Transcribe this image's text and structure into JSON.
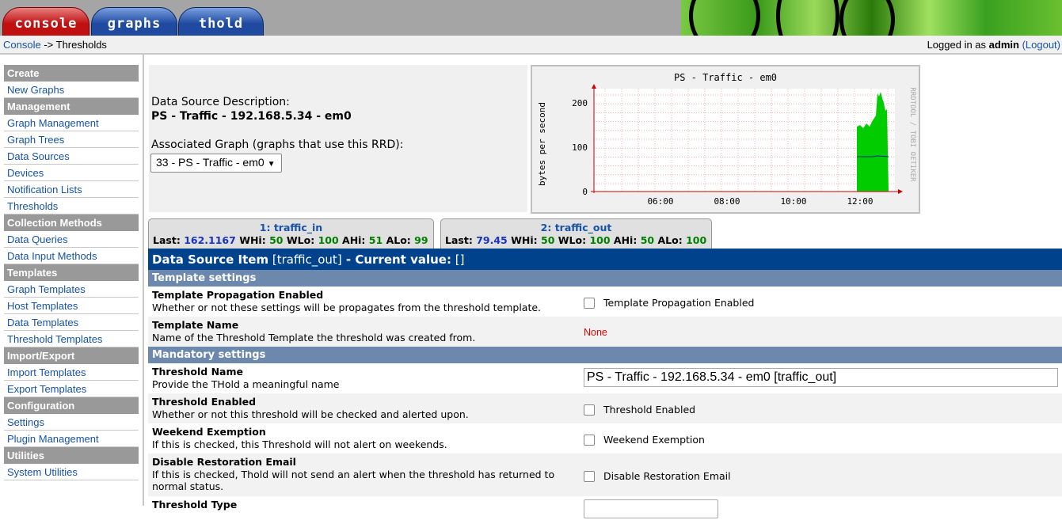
{
  "tabs": [
    {
      "label": "console"
    },
    {
      "label": "graphs"
    },
    {
      "label": "thold"
    }
  ],
  "breadcrumb": {
    "root": "Console",
    "sep": " -> ",
    "current": "Thresholds"
  },
  "login": {
    "prefix": "Logged in as ",
    "user": "admin",
    "logout": "(Logout)"
  },
  "sidebar": {
    "sections": [
      {
        "title": "Create",
        "items": [
          "New Graphs"
        ]
      },
      {
        "title": "Management",
        "items": [
          "Graph Management",
          "Graph Trees",
          "Data Sources",
          "Devices",
          "Notification Lists",
          "Thresholds"
        ]
      },
      {
        "title": "Collection Methods",
        "items": [
          "Data Queries",
          "Data Input Methods"
        ]
      },
      {
        "title": "Templates",
        "items": [
          "Graph Templates",
          "Host Templates",
          "Data Templates",
          "Threshold Templates"
        ]
      },
      {
        "title": "Import/Export",
        "items": [
          "Import Templates",
          "Export Templates"
        ]
      },
      {
        "title": "Configuration",
        "items": [
          "Settings",
          "Plugin Management"
        ]
      },
      {
        "title": "Utilities",
        "items": [
          "System Utilities"
        ]
      }
    ]
  },
  "info": {
    "ds_desc_label": "Data Source Description:",
    "ds_desc_value": "PS - Traffic - 192.168.5.34 - em0",
    "assoc_label": "Associated Graph (graphs that use this RRD):",
    "assoc_select": "33 - PS - Traffic - em0"
  },
  "graph": {
    "title": "PS - Traffic - em0",
    "ylabel": "bytes per second",
    "watermark": "RRDTOOL / TOBI OETIKER",
    "yticks": [
      "200",
      "100",
      "0"
    ],
    "xticks": [
      "06:00",
      "08:00",
      "10:00",
      "12:00"
    ],
    "colors": {
      "area": "#00cc00",
      "line": "#002a97",
      "axis": "#cc0000"
    }
  },
  "dstabs": [
    {
      "title": "1: traffic_in",
      "last_label": "Last:",
      "last": "162.1167",
      "whi_label": "WHi:",
      "whi": "50",
      "wlo_label": "WLo:",
      "wlo": "100",
      "ahi_label": "AHi:",
      "ahi": "51",
      "alo_label": "ALo:",
      "alo": "99"
    },
    {
      "title": "2: traffic_out",
      "last_label": "Last:",
      "last": "79.45",
      "whi_label": "WHi:",
      "whi": "50",
      "wlo_label": "WLo:",
      "wlo": "100",
      "ahi_label": "AHi:",
      "ahi": "50",
      "alo_label": "ALo:",
      "alo": "100"
    }
  ],
  "main": {
    "head_prefix": "Data Source Item",
    "head_item": "[traffic_out]",
    "head_sep": " - ",
    "head_current": "Current value:",
    "head_value": "[]",
    "sections": {
      "template": "Template settings",
      "mandatory": "Mandatory settings"
    },
    "rows": {
      "tpl_prop": {
        "label": "Template Propagation Enabled",
        "desc": "Whether or not these settings will be propagates from the threshold template.",
        "control": "Template Propagation Enabled"
      },
      "tpl_name": {
        "label": "Template Name",
        "desc": "Name of the Threshold Template the threshold was created from.",
        "value": "None"
      },
      "th_name": {
        "label": "Threshold Name",
        "desc": "Provide the THold a meaningful name",
        "value": "PS - Traffic - 192.168.5.34 - em0 [traffic_out]"
      },
      "th_enabled": {
        "label": "Threshold Enabled",
        "desc": "Whether or not this threshold will be checked and alerted upon.",
        "control": "Threshold Enabled"
      },
      "weekend": {
        "label": "Weekend Exemption",
        "desc": "If this is checked, this Threshold will not alert on weekends.",
        "control": "Weekend Exemption"
      },
      "restore": {
        "label": "Disable Restoration Email",
        "desc": "If this is checked, Thold will not send an alert when the threshold has returned to normal status.",
        "control": "Disable Restoration Email"
      },
      "cut": {
        "label": "Threshold Type"
      }
    }
  }
}
